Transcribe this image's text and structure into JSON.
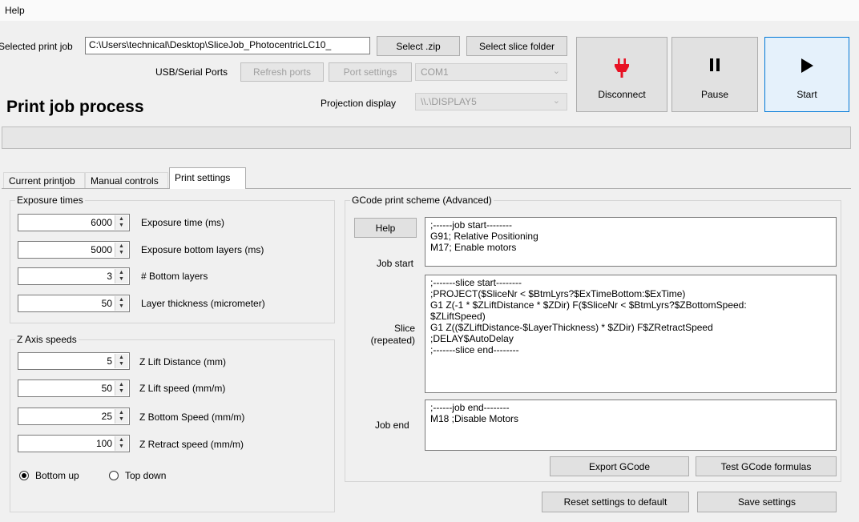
{
  "menu": {
    "help": "Help"
  },
  "job": {
    "selected_label": "Selected print job",
    "path_value": "C:\\Users\\technical\\Desktop\\SliceJob_PhotocentricLC10_",
    "select_zip": "Select .zip",
    "select_slice_folder": "Select slice folder"
  },
  "ports": {
    "label": "USB/Serial Ports",
    "refresh": "Refresh ports",
    "port_settings": "Port settings",
    "com_value": "COM1"
  },
  "projection": {
    "label": "Projection display",
    "value": "\\\\.\\DISPLAY5"
  },
  "actions": {
    "disconnect": "Disconnect",
    "disconnect_icon": "plug-icon",
    "pause": "Pause",
    "pause_icon": "pause-icon",
    "start": "Start",
    "start_icon": "play-icon",
    "disconnect_color": "#e81123"
  },
  "page_title": "Print job process",
  "tabs": [
    "Current printjob",
    "Manual controls",
    "Print settings"
  ],
  "exposure": {
    "title": "Exposure times",
    "rows": [
      {
        "value": "6000",
        "label": "Exposure time (ms)"
      },
      {
        "value": "5000",
        "label": "Exposure bottom layers (ms)"
      },
      {
        "value": "3",
        "label": "# Bottom layers"
      },
      {
        "value": "50",
        "label": "Layer thickness (micrometer)"
      }
    ]
  },
  "zaxis": {
    "title": "Z Axis speeds",
    "rows": [
      {
        "value": "5",
        "label": "Z Lift Distance (mm)"
      },
      {
        "value": "50",
        "label": "Z Lift speed (mm/m)"
      },
      {
        "value": "25",
        "label": "Z Bottom Speed (mm/m)"
      },
      {
        "value": "100",
        "label": "Z Retract speed (mm/m)"
      }
    ],
    "bottom_up": "Bottom up",
    "top_down": "Top down",
    "selected": "bottom_up"
  },
  "gcode": {
    "title": "GCode print scheme (Advanced)",
    "help": "Help",
    "job_start_label": "Job start",
    "slice_label_1": "Slice",
    "slice_label_2": "(repeated)",
    "job_end_label": "Job end",
    "job_start_lines": [
      ";------job start--------",
      "G91; Relative Positioning",
      "M17; Enable motors"
    ],
    "slice_lines": [
      ";-------slice start--------",
      ";PROJECT($SliceNr < $BtmLyrs?$ExTimeBottom:$ExTime)",
      "G1 Z(-1 * $ZLiftDistance * $ZDir) F($SliceNr < $BtmLyrs?$ZBottomSpeed:",
      "$ZLiftSpeed)",
      "G1 Z(($ZLiftDistance-$LayerThickness) * $ZDir) F$ZRetractSpeed",
      ";DELAY$AutoDelay",
      ";-------slice end--------"
    ],
    "job_end_lines": [
      ";------job end--------",
      "M18 ;Disable Motors"
    ],
    "export": "Export GCode",
    "test": "Test GCode formulas"
  },
  "footer": {
    "reset": "Reset settings to default",
    "save": "Save settings"
  }
}
